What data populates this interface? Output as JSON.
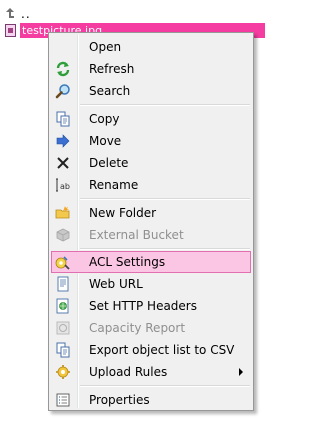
{
  "file_list": {
    "up_label": "..",
    "selected_file": "testpicture.jpg"
  },
  "menu": {
    "items": [
      {
        "label": "Open",
        "icon": "open-icon",
        "disabled": false
      },
      {
        "label": "Refresh",
        "icon": "refresh-icon",
        "disabled": false
      },
      {
        "label": "Search",
        "icon": "search-icon",
        "disabled": false
      },
      {
        "label": "Copy",
        "icon": "copy-icon",
        "disabled": false
      },
      {
        "label": "Move",
        "icon": "move-icon",
        "disabled": false
      },
      {
        "label": "Delete",
        "icon": "delete-icon",
        "disabled": false
      },
      {
        "label": "Rename",
        "icon": "rename-icon",
        "disabled": false
      },
      {
        "label": "New Folder",
        "icon": "new-folder-icon",
        "disabled": false
      },
      {
        "label": "External Bucket",
        "icon": "external-bucket-icon",
        "disabled": true
      },
      {
        "label": "ACL Settings",
        "icon": "acl-settings-icon",
        "disabled": false,
        "highlighted": true
      },
      {
        "label": "Web URL",
        "icon": "web-url-icon",
        "disabled": false
      },
      {
        "label": "Set HTTP Headers",
        "icon": "http-headers-icon",
        "disabled": false
      },
      {
        "label": "Capacity Report",
        "icon": "capacity-report-icon",
        "disabled": true
      },
      {
        "label": "Export object list to CSV",
        "icon": "export-csv-icon",
        "disabled": false
      },
      {
        "label": "Upload Rules",
        "icon": "upload-rules-icon",
        "disabled": false,
        "submenu": true
      },
      {
        "label": "Properties",
        "icon": "properties-icon",
        "disabled": false
      }
    ]
  },
  "colors": {
    "selection": "#f53ca0",
    "hover_fill": "#fbc6e4",
    "hover_border": "#e26fb0",
    "menu_bg": "#f0f0f0"
  }
}
